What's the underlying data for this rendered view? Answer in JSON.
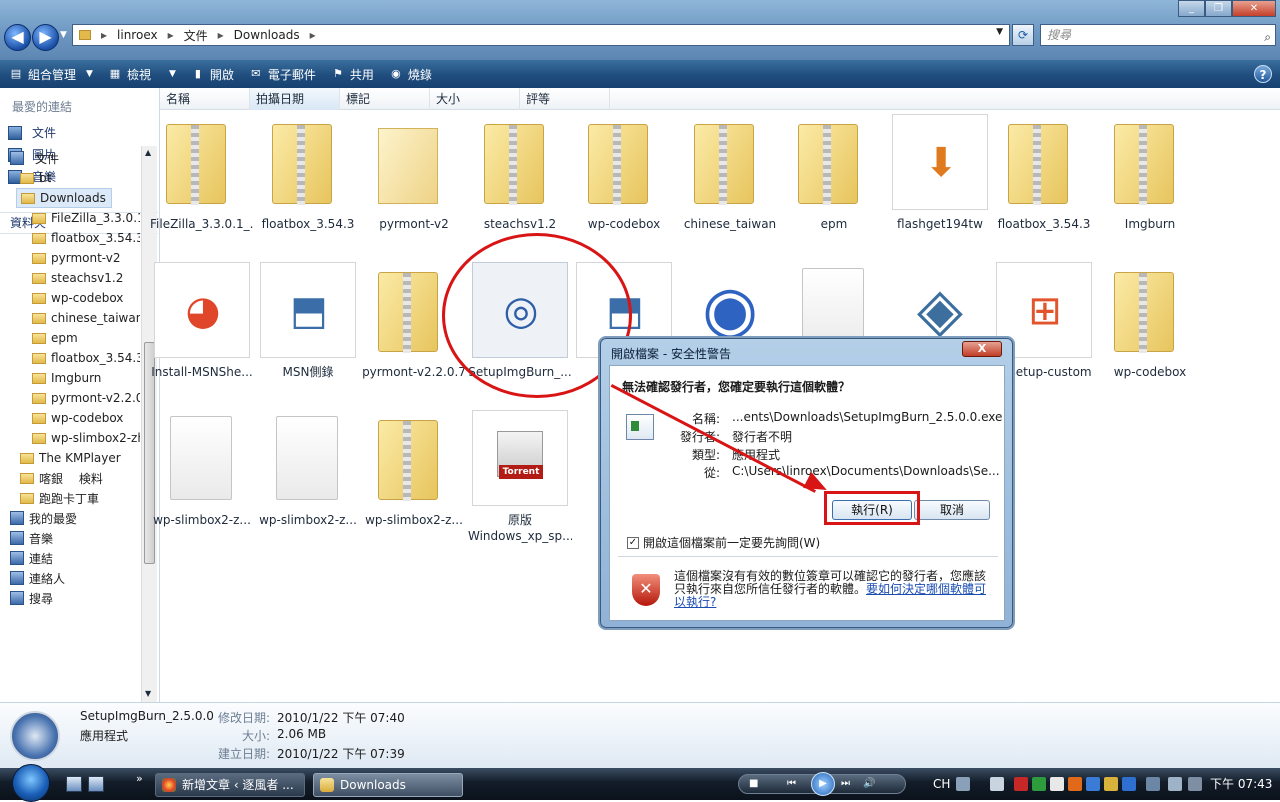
{
  "address": {
    "parts": [
      "linroex",
      "文件",
      "Downloads"
    ]
  },
  "search": {
    "placeholder": "搜尋"
  },
  "toolbar": {
    "organize": "組合管理",
    "views": "檢視",
    "open": "開啟",
    "email": "電子郵件",
    "share": "共用",
    "burn": "燒錄"
  },
  "nav": {
    "favorites_title": "最愛的連結",
    "favorites": [
      "文件",
      "圖片",
      "音樂"
    ],
    "more": "其他",
    "more_chevron": "»",
    "folders_title": "資料夾",
    "tree": [
      "文件",
      "bt",
      "Downloads",
      "FileZilla_3.3.0.1_",
      "floatbox_3.54.3",
      "pyrmont-v2",
      "steachsv1.2",
      "wp-codebox",
      "chinese_taiwan",
      "epm",
      "floatbox_3.54.3",
      "Imgburn",
      "pyrmont-v2.2.0",
      "wp-codebox",
      "wp-slimbox2-zh",
      "The KMPlayer",
      "喀銀　 検料",
      "跑跑卡丁車",
      "我的最愛",
      "音樂",
      "連結",
      "連絡人",
      "搜尋"
    ]
  },
  "columns": [
    "名稱",
    "拍攝日期",
    "標記",
    "大小",
    "評等"
  ],
  "files": [
    "FileZilla_3.3.0.1_...",
    "floatbox_3.54.3",
    "pyrmont-v2",
    "steachsv1.2",
    "wp-codebox",
    "chinese_taiwan",
    "epm",
    "flashget194tw",
    "floatbox_3.54.3",
    "Imgburn",
    "Install-MSNShe...",
    "MSN側錄",
    "pyrmont-v2.2.0.7",
    "SetupImgBurn_...",
    "Sk",
    "",
    "",
    "",
    "wlsetup-custom",
    "wp-codebox",
    "wp-slimbox2-z...",
    "wp-slimbox2-z...",
    "wp-slimbox2-z...",
    "原版\nWindows_xp_sp..."
  ],
  "torrent_label": "Torrent",
  "dialog": {
    "title": "開啟檔案 - 安全性警告",
    "close": "X",
    "question": "無法確認發行者，您確定要執行這個軟體？",
    "name_label": "名稱:",
    "name": "...ents\\Downloads\\SetupImgBurn_2.5.0.0.exe",
    "publisher_label": "發行者:",
    "publisher": "發行者不明",
    "type_label": "類型:",
    "type": "應用程式",
    "from_label": "從:",
    "from": "C:\\Users\\linroex\\Documents\\Downloads\\Se...",
    "run": "執行(R)",
    "cancel": "取消",
    "checkbox": "開啟這個檔案前一定要先詢問(W)",
    "warning": "這個檔案沒有有效的數位簽章可以確認它的發行者，您應該只執行來自您所信任發行者的軟體。",
    "warning_link": "要如何決定哪個軟體可以執行?"
  },
  "details": {
    "name": "SetupImgBurn_2.5.0.0",
    "kind": "應用程式",
    "modified_label": "修改日期:",
    "modified": "2010/1/22 下午 07:40",
    "size_label": "大小:",
    "size": "2.06 MB",
    "created_label": "建立日期:",
    "created": "2010/1/22 下午 07:39"
  },
  "taskbar": {
    "task1": "新增文章 ‹ 逐風者 ...",
    "task2": "Downloads",
    "lang": "CH",
    "clock": "下午 07:43",
    "overflow": "»"
  }
}
